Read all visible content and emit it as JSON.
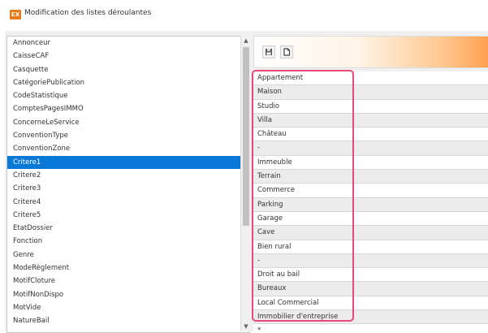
{
  "window": {
    "icon_label": "EX",
    "title": "Modification des listes déroulantes"
  },
  "list": {
    "items": [
      "Annonceur",
      "CaisseCAF",
      "Casquette",
      "CatégoriePublication",
      "CodeStatistique",
      "ComptesPagesIMMO",
      "ConcerneLeService",
      "ConventionType",
      "ConventionZone",
      "Critere1",
      "Critere2",
      "Critere3",
      "Critere4",
      "Critere5",
      "EtatDossier",
      "Fonction",
      "Genre",
      "ModeRèglement",
      "MotifCloture",
      "MotifNonDispo",
      "MotVide",
      "NatureBail"
    ],
    "selected_index": 9
  },
  "toolbar": {
    "buttons": [
      "save-icon",
      "new-document-icon"
    ],
    "accent_color": "#ff9f50"
  },
  "values": [
    "Appartement",
    "Maison",
    "Studio",
    "Villa",
    "Château",
    "-",
    "Immeuble",
    "Terrain",
    "Commerce",
    "Parking",
    "Garage",
    "Cave",
    "Bien rural",
    "-",
    "Droit au bail",
    "Bureaux",
    "Local Commercial",
    "Immobilier d'entreprise",
    "*"
  ],
  "colors": {
    "selection": "#0a78d7",
    "highlight_border": "#e8487a",
    "window_icon": "#e97a1a"
  }
}
